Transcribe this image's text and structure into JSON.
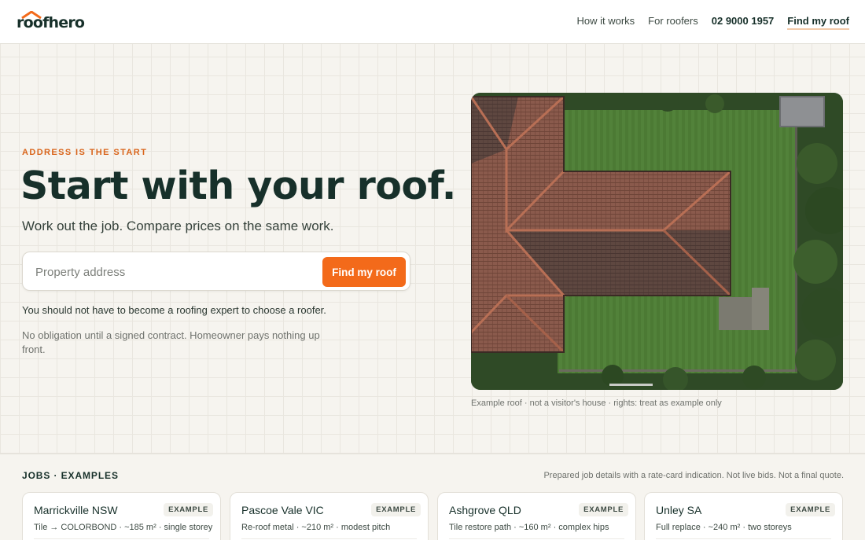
{
  "brand": {
    "name": "roofhero",
    "accent": "#f36a1a",
    "dark": "#17302a"
  },
  "nav": {
    "how_it_works": "How it works",
    "for_roofers": "For roofers",
    "phone": "02 9000 1957",
    "find_my_roof": "Find my roof"
  },
  "hero": {
    "eyebrow": "ADDRESS IS THE START",
    "headline": "Start with your roof.",
    "subhead": "Work out the job. Compare prices on the same work.",
    "search": {
      "placeholder": "Property address",
      "value": "",
      "button_label": "Find my roof"
    },
    "tagline": "You should not have to become a roofing expert to choose a roofer.",
    "disclaimer": "No obligation until a signed contract. Homeowner pays nothing up front."
  },
  "image": {
    "caption": "Example roof · not a visitor's house · rights: treat as example only"
  },
  "jobs": {
    "heading": "JOBS · EXAMPLES",
    "note": "Prepared job details with a rate-card indication. Not live bids. Not a final quote.",
    "cards": [
      {
        "title": "Marrickville NSW",
        "badge": "EXAMPLE",
        "detail": "Tile → COLORBOND · ~185 m² · single storey"
      },
      {
        "title": "Pascoe Vale VIC",
        "badge": "EXAMPLE",
        "detail": "Re-roof metal · ~210 m² · modest pitch"
      },
      {
        "title": "Ashgrove QLD",
        "badge": "EXAMPLE",
        "detail": "Tile restore path · ~160 m² · complex hips"
      },
      {
        "title": "Unley SA",
        "badge": "EXAMPLE",
        "detail": "Full replace · ~240 m² · two storeys"
      }
    ]
  }
}
